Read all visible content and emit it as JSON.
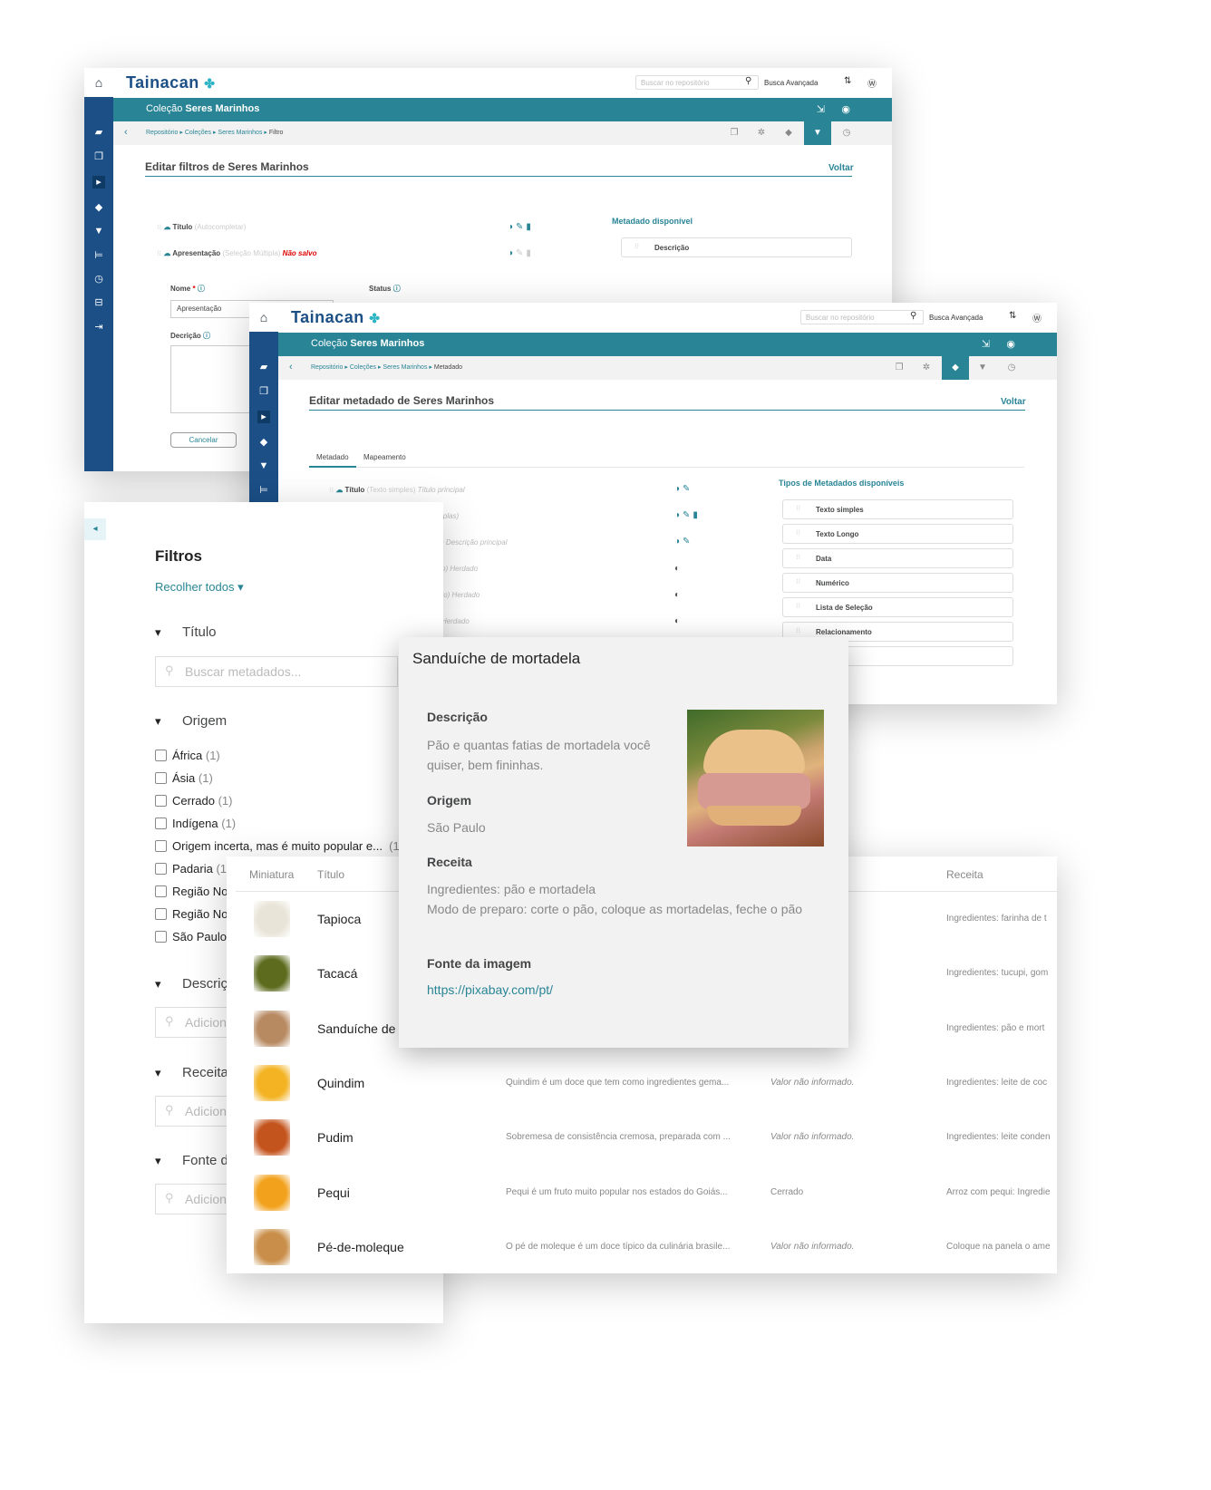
{
  "brand": "Tainacan",
  "search_placeholder": "Buscar no repositório",
  "advanced_search": "Busca Avançada",
  "collection_prefix": "Coleção",
  "collection_name": "Seres Marinhos",
  "crumbs": {
    "repo": "Repositório",
    "cols": "Coleções",
    "col": "Seres Marinhos",
    "filter": "Filtro",
    "metadata": "Metadado"
  },
  "voltar": "Voltar",
  "win1": {
    "title": "Editar filtros de Seres Marinhos",
    "rows": [
      {
        "name": "Título",
        "type": "(Autocompletar)"
      },
      {
        "name": "Apresentação",
        "type": "(Seleção Múltipla)",
        "flag": "Não salvo"
      }
    ],
    "side_title": "Metadado disponível",
    "side_item": "Descrição",
    "name_label": "Nome",
    "name_value": "Apresentação",
    "status_label": "Status",
    "desc_label": "Decrição",
    "cancel": "Cancelar"
  },
  "win2": {
    "title": "Editar metadado de Seres Marinhos",
    "tabs": [
      "Metadado",
      "Mapeamento"
    ],
    "row1": {
      "name": "Título",
      "type": "(Texto simples)",
      "extra": "Título principal"
    },
    "partials": [
      "iplas)",
      ") Descrição principal",
      "o) Herdado",
      "to) Herdado",
      "Herdado"
    ],
    "side_title": "Tipos de Metadados disponíveis",
    "types": [
      "Texto simples",
      "Texto Longo",
      "Data",
      "Numérico",
      "Lista de Seleção",
      "Relacionamento",
      "ia"
    ]
  },
  "filters": {
    "title": "Filtros",
    "collapse": "Recolher todos",
    "titulo": "Título",
    "search_meta": "Buscar metadados...",
    "origem": "Origem",
    "options": [
      {
        "label": "África",
        "count": "(1)"
      },
      {
        "label": "Ásia",
        "count": "(1)"
      },
      {
        "label": "Cerrado",
        "count": "(1)"
      },
      {
        "label": "Indígena",
        "count": "(1)"
      },
      {
        "label": "Origem incerta, mas é muito popular e...",
        "count": "(1)"
      },
      {
        "label": "Padaria",
        "count": "(1)"
      },
      {
        "label": "Região Nor",
        "count": ""
      },
      {
        "label": "Região Nor",
        "count": ""
      },
      {
        "label": "São Paulo",
        "count": ""
      }
    ],
    "descricao": "Descriç",
    "receita": "Receita",
    "fonte": "Fonte d",
    "add": "Adicion"
  },
  "table": {
    "headers": {
      "thumb": "Miniatura",
      "title": "Título",
      "recipe": "Receita"
    },
    "rows": [
      {
        "title": "Tapioca",
        "desc": "",
        "origin": "",
        "recipe": "Ingredientes: farinha de t",
        "thumb": "#e9e4d8"
      },
      {
        "title": "Tacacá",
        "desc": "",
        "origin": "",
        "recipe": "Ingredientes: tucupi, gom",
        "thumb": "#5d6b1e"
      },
      {
        "title": "Sanduíche de m",
        "desc": "",
        "origin": "",
        "recipe": "Ingredientes: pão e mort",
        "thumb": "#b78a62"
      },
      {
        "title": "Quindim",
        "desc": "Quindim é um doce que tem como ingredientes gema...",
        "origin": "Valor não informado.",
        "recipe": "Ingredientes: leite de coc",
        "thumb": "#f3b323"
      },
      {
        "title": "Pudim",
        "desc": "Sobremesa de consistência cremosa, preparada com ...",
        "origin": "Valor não informado.",
        "recipe": "Ingredientes: leite conden",
        "thumb": "#c4541d"
      },
      {
        "title": "Pequi",
        "desc": "Pequi é um fruto muito popular nos estados do Goiás...",
        "origin": "Cerrado",
        "recipe": "Arroz com pequi: Ingredie",
        "thumb": "#f2a11c"
      },
      {
        "title": "Pé-de-moleque",
        "desc": "O pé de moleque é um doce típico da culinária brasile...",
        "origin": "Valor não informado.",
        "recipe": "Coloque na panela o ame",
        "thumb": "#c98f4a"
      }
    ]
  },
  "modal": {
    "title": "Sanduíche de mortadela",
    "desc_h": "Descrição",
    "desc": "Pão e quantas fatias de mortadela você quiser, bem fininhas.",
    "origin_h": "Origem",
    "origin": "São Paulo",
    "recipe_h": "Receita",
    "recipe1": "Ingredientes: pão e mortadela",
    "recipe2": "Modo de preparo: corte o pão, coloque as mortadelas, feche o pão",
    "source_h": "Fonte da imagem",
    "source": "https://pixabay.com/pt/"
  }
}
